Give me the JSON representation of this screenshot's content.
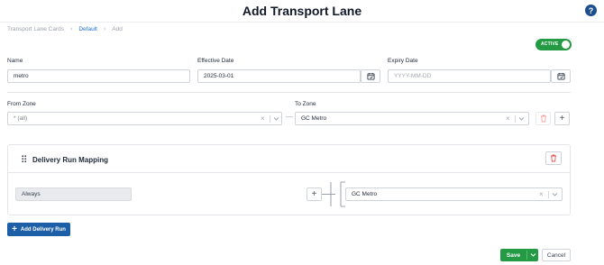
{
  "header": {
    "title": "Add Transport Lane",
    "help_label": "?"
  },
  "breadcrumb": {
    "items": [
      "Transport Lane Cards",
      "Default",
      "Add"
    ]
  },
  "status_toggle": {
    "label": "ACTIVE",
    "on": true,
    "color": "#239a43"
  },
  "form": {
    "name": {
      "label": "Name",
      "value": "metro"
    },
    "effective_date": {
      "label": "Effective Date",
      "value": "2025-03-01"
    },
    "expiry_date": {
      "label": "Expiry Date",
      "placeholder": "YYYY-MM-DD"
    },
    "from_zone": {
      "label": "From Zone",
      "value": "* (all)"
    },
    "to_zone": {
      "label": "To Zone",
      "value": "GC Metro"
    },
    "separator": "—"
  },
  "delivery_run_mapping": {
    "title": "Delivery Run Mapping",
    "condition": "Always",
    "run_value": "GC Metro"
  },
  "actions": {
    "add_delivery_run": "Add Delivery Run",
    "save": "Save",
    "cancel": "Cancel"
  },
  "colors": {
    "primary": "#1d5fa6",
    "success": "#239a43",
    "link": "#1d6fd1"
  }
}
